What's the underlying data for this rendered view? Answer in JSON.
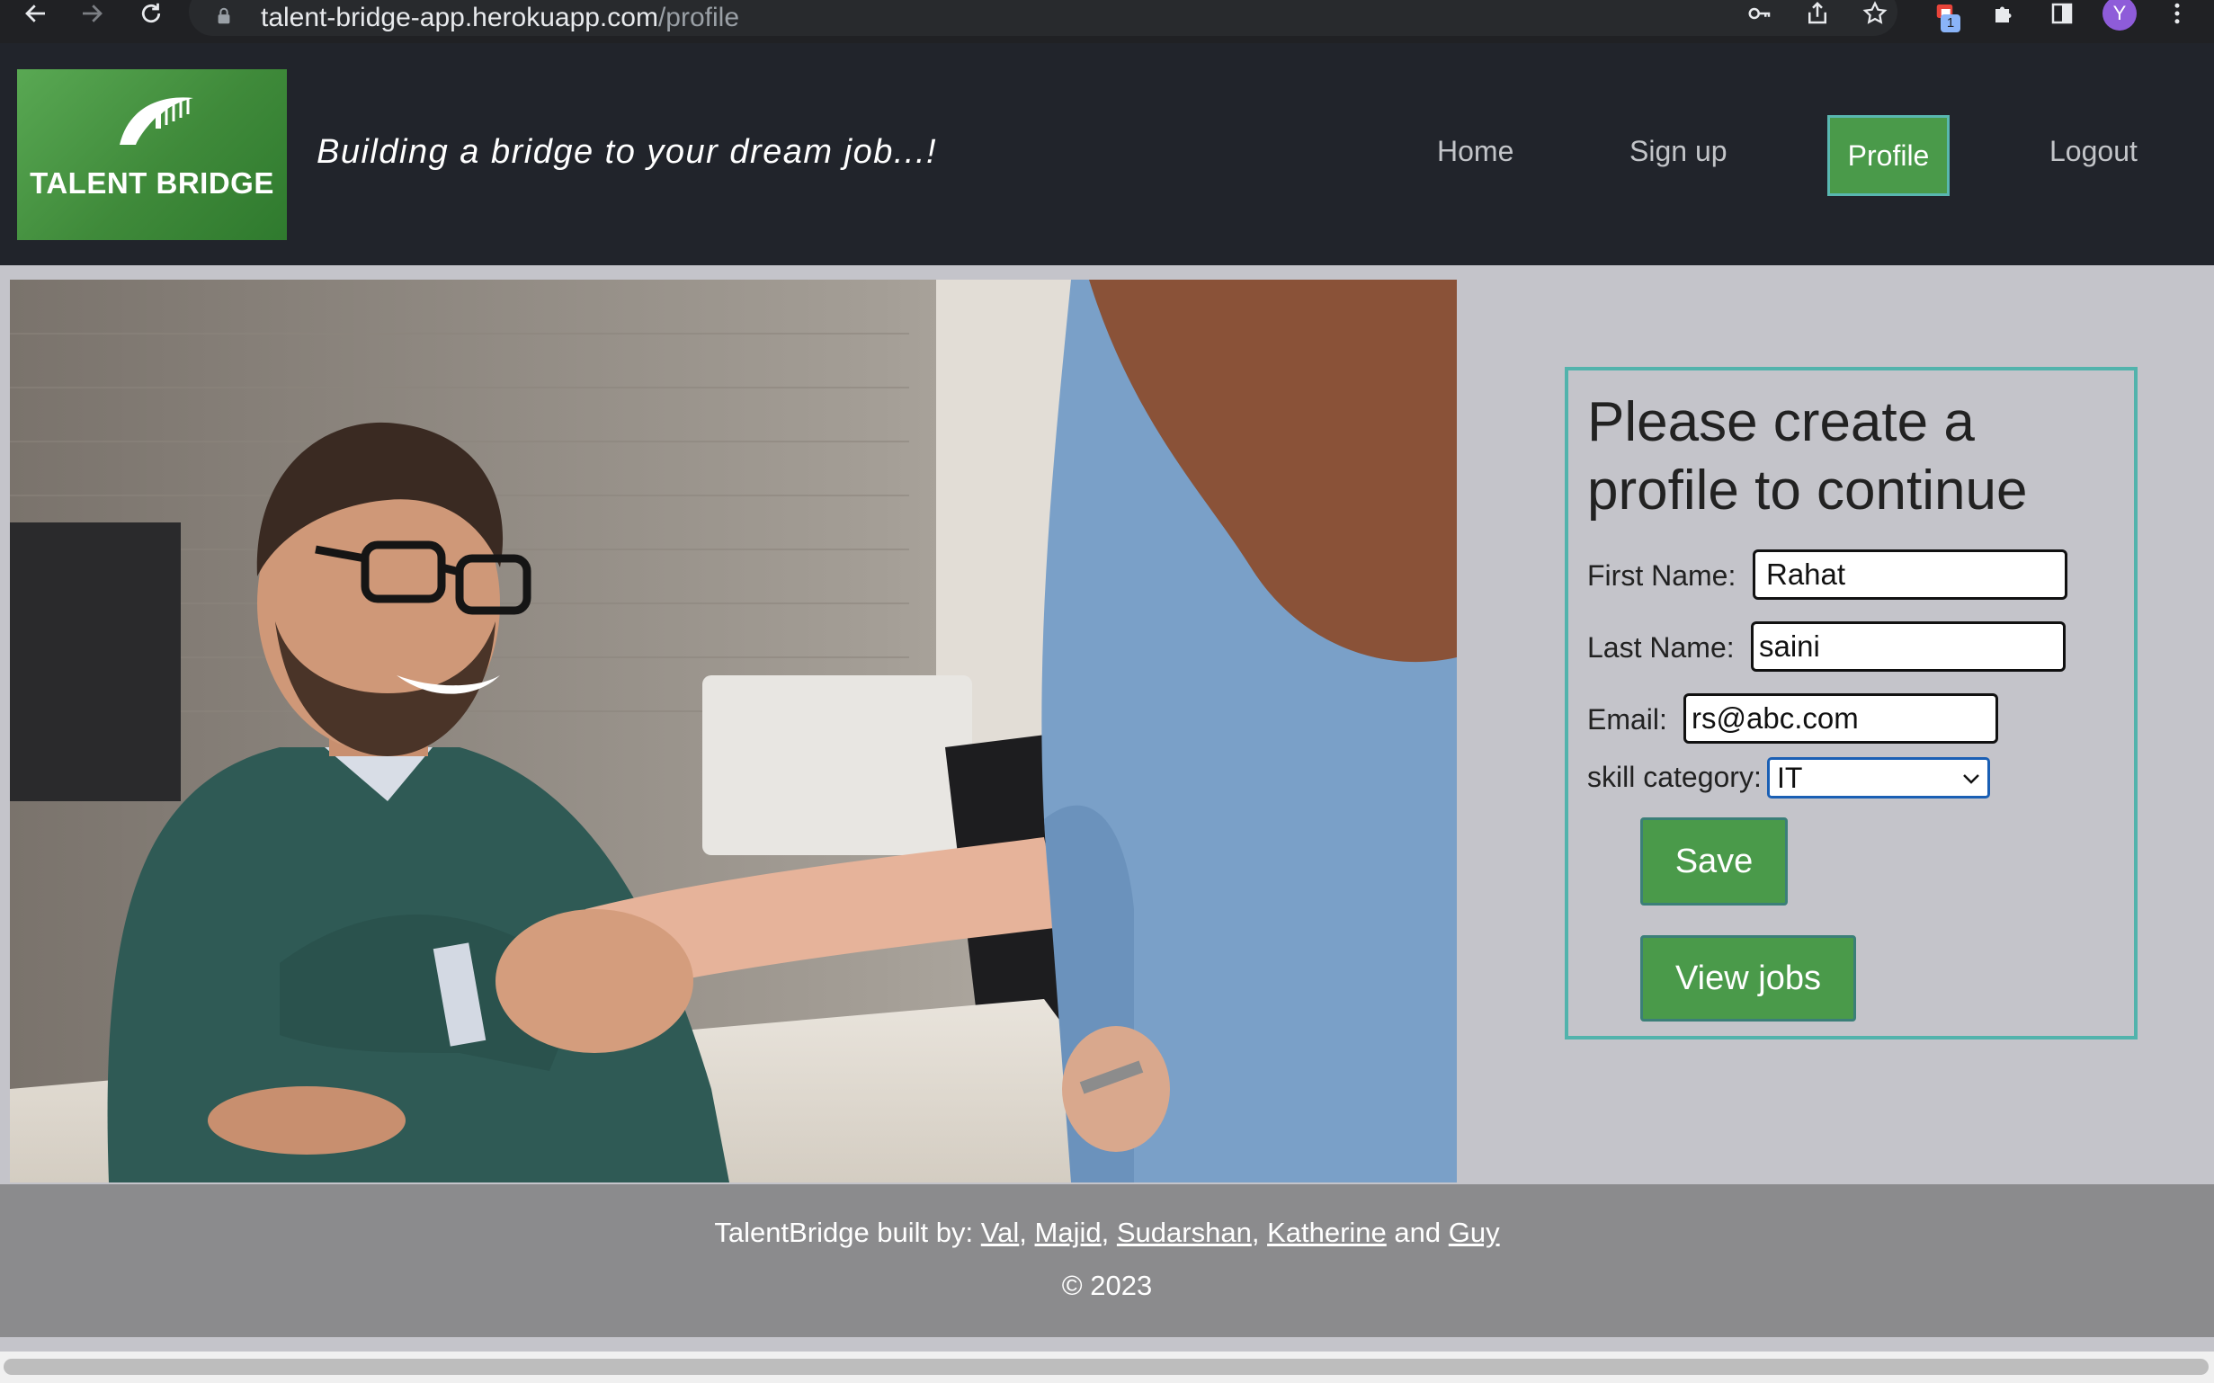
{
  "browser": {
    "url_host": "talent-bridge-app.herokuapp.com",
    "url_path": "/profile",
    "extension_badge": "1",
    "profile_initial": "Y"
  },
  "header": {
    "logo_text": "TALENT BRIDGE",
    "tagline": "Building a bridge to your dream job...!",
    "nav": {
      "home": "Home",
      "signup": "Sign up",
      "profile": "Profile",
      "logout": "Logout"
    }
  },
  "form": {
    "title": "Please create a profile to continue",
    "first_name_label": "First Name:",
    "first_name_value": "Rahat",
    "last_name_label": "Last Name:",
    "last_name_value": "saini",
    "email_label": "Email:",
    "email_value": "rs@abc.com",
    "skill_label": "skill category:",
    "skill_value": "IT",
    "save_label": "Save",
    "view_jobs_label": "View jobs"
  },
  "footer": {
    "built_by_prefix": "TalentBridge built by:",
    "authors": [
      "Val",
      "Majid",
      "Sudarshan",
      "Katherine",
      "Guy"
    ],
    "sep_comma": ",",
    "sep_and": "and",
    "copyright": "© 2023"
  },
  "colors": {
    "header_bg": "#21242b",
    "accent_green": "#4a9a4a",
    "accent_teal": "#52b3ac",
    "page_bg": "#c4c4ca",
    "footer_bg": "#8b8b8d"
  }
}
